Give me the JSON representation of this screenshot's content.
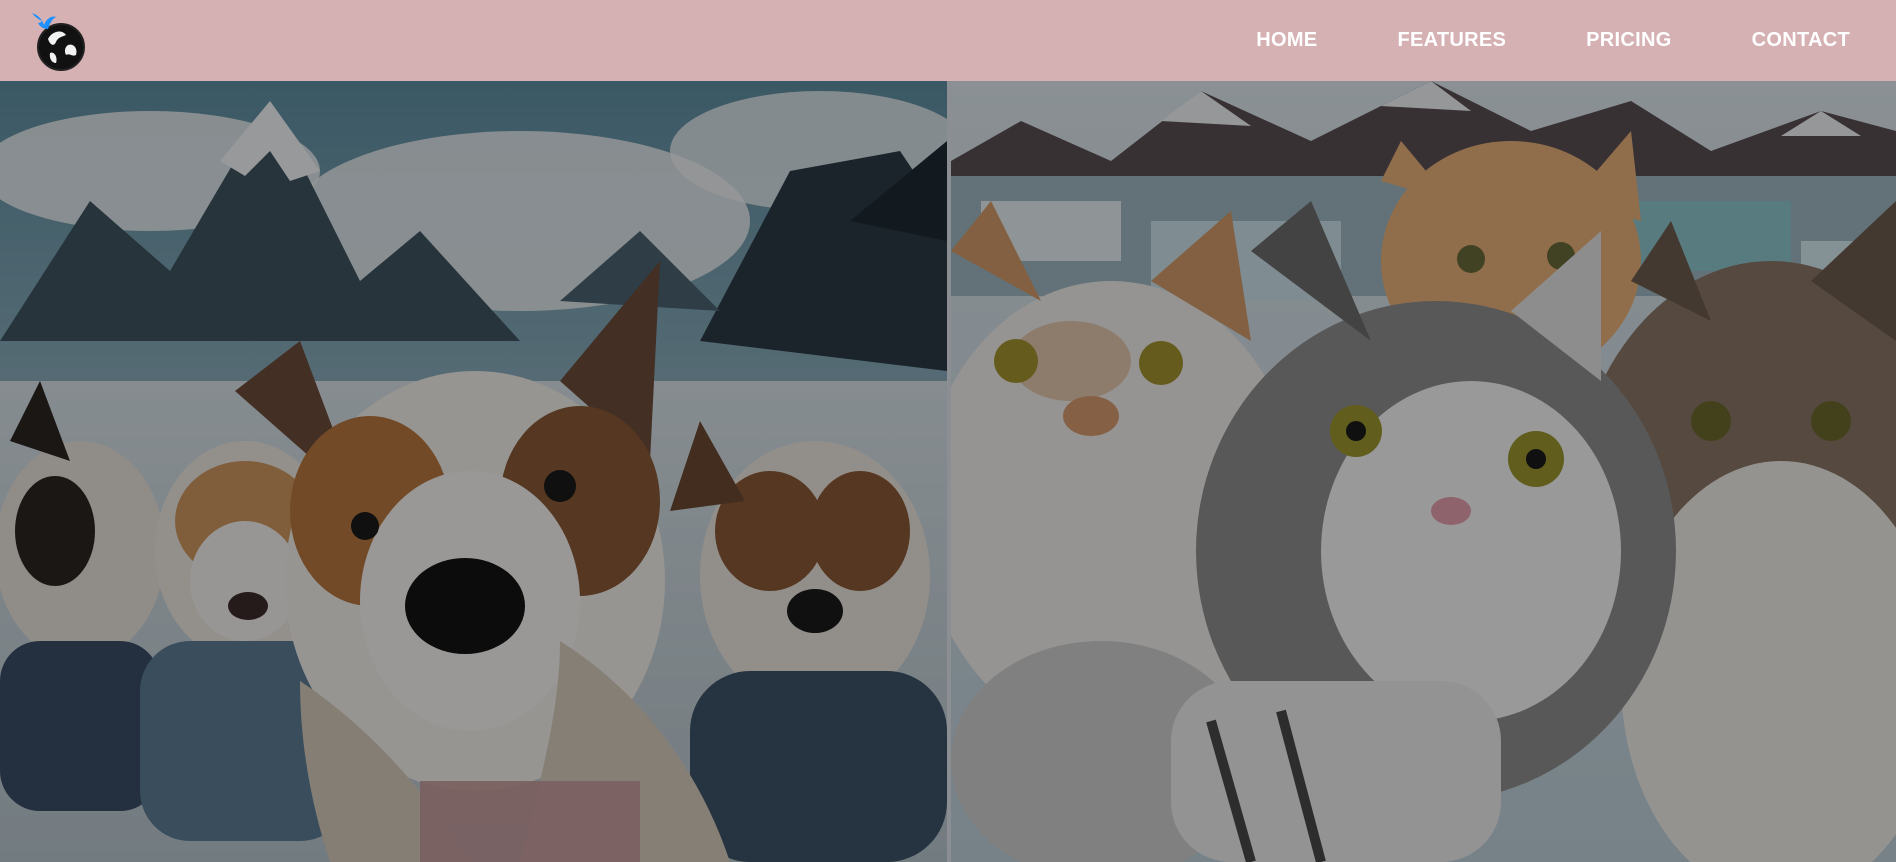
{
  "brand": {
    "logo_icon": "bird-globe-logo-icon",
    "colors": {
      "navbar_bg": "#d6b1b4",
      "nav_text": "#ffffff",
      "bird": "#1e90ff"
    }
  },
  "nav": {
    "items": [
      {
        "label": "HOME"
      },
      {
        "label": "FEATURES"
      },
      {
        "label": "PRICING"
      },
      {
        "label": "CONTACT"
      }
    ]
  },
  "hero": {
    "left_image": "dogs-selfie-in-snowy-mountains",
    "right_image": "cats-selfie-by-glacier-lake"
  }
}
